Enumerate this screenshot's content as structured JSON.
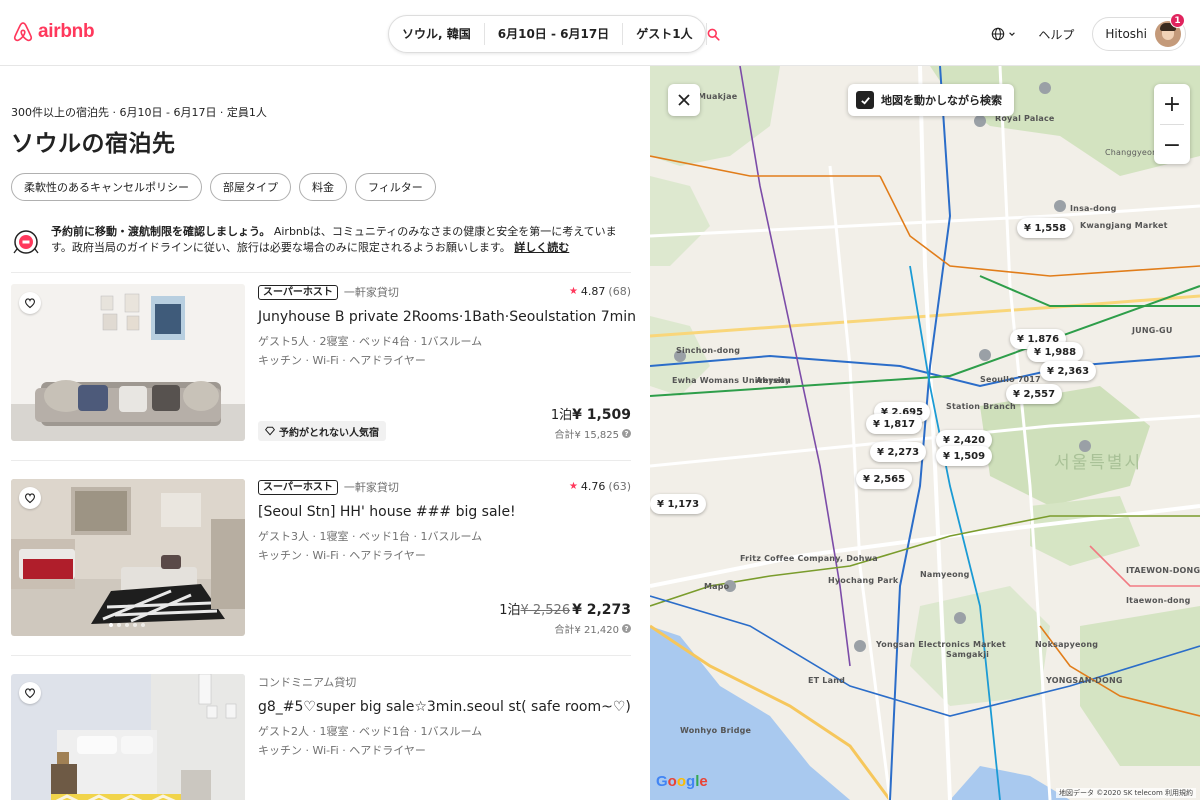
{
  "header": {
    "logo_text": "airbnb",
    "search": {
      "location": "ソウル, 韓国",
      "dates": "6月10日 - 6月17日",
      "guests": "ゲスト1人"
    },
    "help": "ヘルプ",
    "user_name": "Hitoshi",
    "notifications": "1",
    "accent": "#FF385C"
  },
  "results": {
    "summary": "300件以上の宿泊先 · 6月10日 - 6月17日 · 定員1人",
    "title": "ソウルの宿泊先",
    "filters": [
      "柔軟性のあるキャンセルポリシー",
      "部屋タイプ",
      "料金",
      "フィルター"
    ]
  },
  "notice": {
    "bold": "予約前に移動・渡航制限を確認しましょう。",
    "text": "Airbnbは、コミュニティのみなさまの健康と安全を第一に考えています。政府当局のガイドラインに従い、旅行は必要な場合のみに限定されるようお願いします。",
    "link": "詳しく読む"
  },
  "listings": [
    {
      "badge": "スーパーホスト",
      "type": "一軒家貸切",
      "rating": "4.87",
      "reviews": "(68)",
      "title": "Junyhouse B private 2Rooms·1Bath·Seoulstation 7min",
      "details": "ゲスト5人 · 2寝室 · ベッド4台 · 1バスルーム",
      "amenities": "キッチン · Wi-Fi · ヘアドライヤー",
      "popular": "予約がとれない人気宿",
      "price_unit": "1泊",
      "price_original": "",
      "price": "¥ 1,509",
      "total": "合計¥ 15,825"
    },
    {
      "badge": "スーパーホスト",
      "type": "一軒家貸切",
      "rating": "4.76",
      "reviews": "(63)",
      "title": "[Seoul Stn] HH' house ### big sale!",
      "details": "ゲスト3人 · 1寝室 · ベッド1台 · 1バスルーム",
      "amenities": "キッチン · Wi-Fi · ヘアドライヤー",
      "popular": "",
      "price_unit": "1泊",
      "price_original": "¥ 2,526",
      "price": "¥ 2,273",
      "total": "合計¥ 21,420"
    },
    {
      "badge": "",
      "type": "コンドミニアム貸切",
      "rating": "",
      "reviews": "",
      "title": "g8_#5♡super big sale☆3min.seoul st( safe room~♡)",
      "details": "ゲスト2人 · 1寝室 · ベッド1台 · 1バスルーム",
      "amenities": "キッチン · Wi-Fi · ヘアドライヤー",
      "popular": "",
      "price_unit": "",
      "price_original": "",
      "price": "",
      "total": ""
    }
  ],
  "map": {
    "search_as_move": "地図を動かしながら検索",
    "zoom_in": "+",
    "zoom_out": "−",
    "price_pins": [
      "¥ 1,558",
      "¥ 1,876",
      "¥ 1,988",
      "¥ 2,363",
      "¥ 2,557",
      "¥ 2,695",
      "¥ 1,817",
      "¥ 2,420",
      "¥ 1,509",
      "¥ 2,273",
      "¥ 2,565",
      "¥ 1,173"
    ],
    "labels": {
      "muakjae": "Muakjae",
      "royal_palace": "Royal Palace",
      "insa_dong": "Insa-dong",
      "kwangjang": "Kwangjang Market",
      "sinchon": "Sinchon-dong",
      "ewha": "Ewha Womans University",
      "ahyeon": "Ahyeon",
      "seoullo": "Seoullo 7017",
      "station_branch": "Station Branch",
      "fritz": "Fritz Coffee Company, Dohwa",
      "hyochang": "Hyochang Park",
      "namyeong": "Namyeong",
      "mapo": "Mapo",
      "yongsan_elec": "Yongsan Electronics Market",
      "samgakji": "Samgakji",
      "et_land": "ET Land",
      "wonhyo": "Wonhyo Bridge",
      "itaewon": "ITAEWON-DONG",
      "itaewon2": "Itaewon-dong",
      "noksapyeong": "Noksapyeong",
      "yongsan_dong": "YONGSAN-DONG",
      "jung_gu": "JUNG-GU",
      "changgyeong": "Changgyeonggung",
      "seoul_big": "서울특별시"
    },
    "google": "Google",
    "attribution": "地図データ ©2020 SK telecom  利用規約"
  }
}
